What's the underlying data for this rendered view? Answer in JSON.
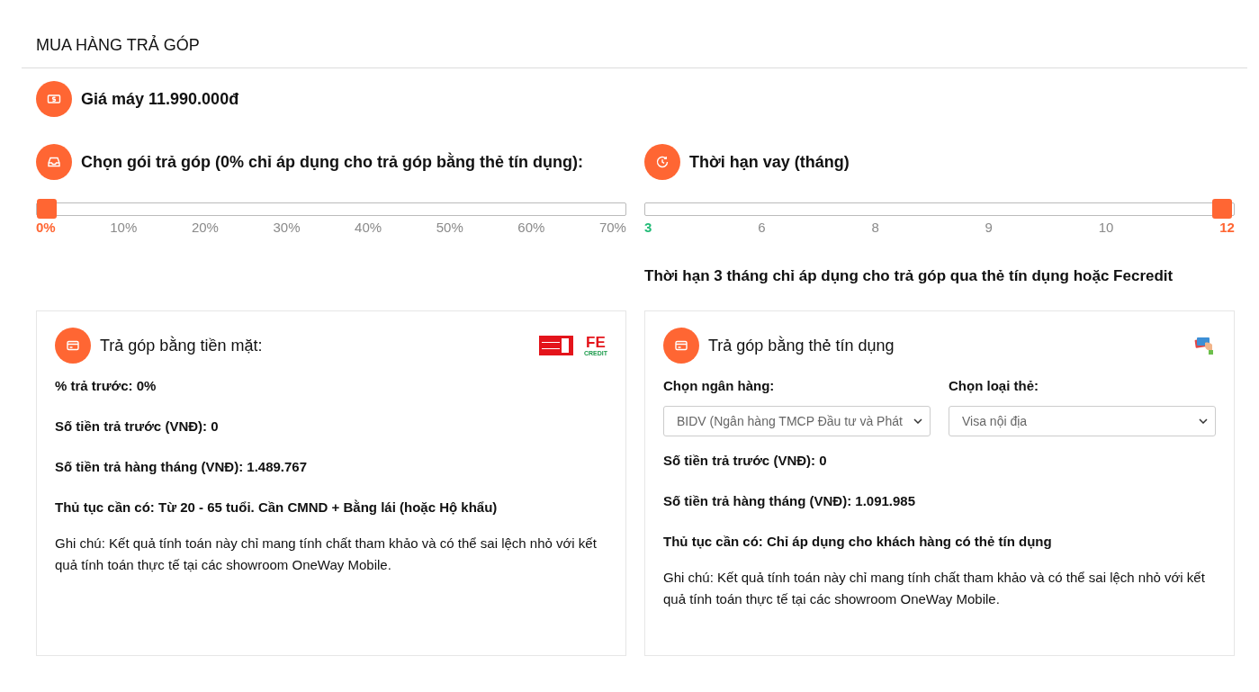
{
  "title": "MUA HÀNG TRẢ GÓP",
  "price": {
    "label": "Giá máy 11.990.000đ"
  },
  "package": {
    "label": "Chọn gói trả góp (0% chỉ áp dụng cho trả góp bằng thẻ tín dụng):",
    "level": 0,
    "ticks": [
      {
        "label": "0%",
        "color": "#ff6633"
      },
      {
        "label": "10%",
        "color": "#8a8a8a"
      },
      {
        "label": "20%",
        "color": "#8a8a8a"
      },
      {
        "label": "30%",
        "color": "#8a8a8a"
      },
      {
        "label": "40%",
        "color": "#8a8a8a"
      },
      {
        "label": "50%",
        "color": "#8a8a8a"
      },
      {
        "label": "60%",
        "color": "#8a8a8a"
      },
      {
        "label": "70%",
        "color": "#8a8a8a"
      }
    ]
  },
  "term": {
    "label": "Thời hạn vay (tháng)",
    "level": 1,
    "ticks": [
      {
        "label": "3",
        "color": "#22bb77"
      },
      {
        "label": "6",
        "color": "#8a8a8a"
      },
      {
        "label": "8",
        "color": "#8a8a8a"
      },
      {
        "label": "9",
        "color": "#8a8a8a"
      },
      {
        "label": "10",
        "color": "#8a8a8a"
      },
      {
        "label": "12",
        "color": "#ff6633"
      }
    ],
    "note": "Thời hạn 3 tháng chỉ áp dụng cho trả góp qua thẻ tín dụng hoặc Fecredit"
  },
  "cards": [
    {
      "kind": "cash",
      "title": "Trả góp bằng tiền mặt:",
      "logos": [
        {
          "kind": "home_credit"
        },
        {
          "kind": "fe_credit",
          "text": "FE",
          "subtext": "CREDIT"
        }
      ],
      "lines": [
        "% trả trước: 0%",
        "Số tiền trả trước (VNĐ): 0",
        "Số tiền trả hàng tháng (VNĐ): 1.489.767",
        "Thủ tục cần có: Từ 20 - 65 tuổi. Cần CMND + Bằng lái (hoặc Hộ khẩu)"
      ],
      "note": "Ghi chú: Kết quả tính toán này chỉ mang tính chất tham khảo và có thể sai lệch nhỏ với kết quả tính toán thực tế tại các showroom OneWay Mobile."
    },
    {
      "kind": "credit",
      "title": "Trả góp bằng thẻ tín dụng",
      "logos": [
        {
          "kind": "card_hand"
        }
      ],
      "selects": [
        {
          "label": "Chọn ngân hàng:",
          "value": "BIDV (Ngân hàng TMCP Đầu tư và Phát"
        },
        {
          "label": "Chọn loại thẻ:",
          "value": "Visa nội địa"
        }
      ],
      "lines": [
        "Số tiền trả trước (VNĐ): 0",
        "Số tiền trả hàng tháng (VNĐ): 1.091.985",
        "Thủ tục cần có: Chỉ áp dụng cho khách hàng có thẻ tín dụng"
      ],
      "note": "Ghi chú: Kết quả tính toán này chỉ mang tính chất tham khảo và có thể sai lệch nhỏ với kết quả tính toán thực tế tại các showroom OneWay Mobile."
    }
  ]
}
